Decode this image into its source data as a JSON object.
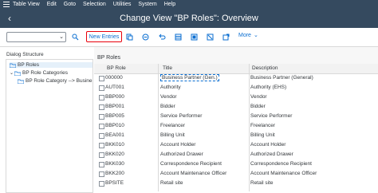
{
  "menubar": {
    "items": [
      "Table View",
      "Edit",
      "Goto",
      "Selection",
      "Utilities",
      "System",
      "Help"
    ]
  },
  "titlebar": {
    "title": "Change View \"BP Roles\": Overview"
  },
  "toolbar": {
    "new_entries_label": "New Entries",
    "more_label": "More"
  },
  "dialog_structure": {
    "title": "Dialog Structure",
    "items": [
      {
        "label": "BP Roles"
      },
      {
        "label": "BP Role Categories"
      },
      {
        "label": "BP Role Category --> Busine"
      }
    ]
  },
  "table": {
    "section_title": "BP Roles",
    "columns": [
      "BP Role",
      "Title",
      "Description"
    ],
    "rows": [
      {
        "role": "000000",
        "title": "Business Partner (Gen.)",
        "description": "Business Partner (General)"
      },
      {
        "role": "AUT001",
        "title": "Authority",
        "description": "Authority (EHS)"
      },
      {
        "role": "BBP000",
        "title": "Vendor",
        "description": "Vendor"
      },
      {
        "role": "BBP001",
        "title": "Bidder",
        "description": "Bidder"
      },
      {
        "role": "BBP005",
        "title": "Service Performer",
        "description": "Service Performer"
      },
      {
        "role": "BBP010",
        "title": "Freelancer",
        "description": "Freelancer"
      },
      {
        "role": "BEA001",
        "title": "Billing Unit",
        "description": "Billing Unit"
      },
      {
        "role": "BKK010",
        "title": "Account Holder",
        "description": "Account Holder"
      },
      {
        "role": "BKK020",
        "title": "Authorized Drawer",
        "description": "Authorized Drawer"
      },
      {
        "role": "BKK030",
        "title": "Correspondence Recipient",
        "description": "Correspondence Recipient"
      },
      {
        "role": "BKK200",
        "title": "Account Maintenance Officer",
        "description": "Account Maintenance Officer"
      },
      {
        "role": "BPSITE",
        "title": "Retail site",
        "description": "Retail site"
      }
    ]
  }
}
